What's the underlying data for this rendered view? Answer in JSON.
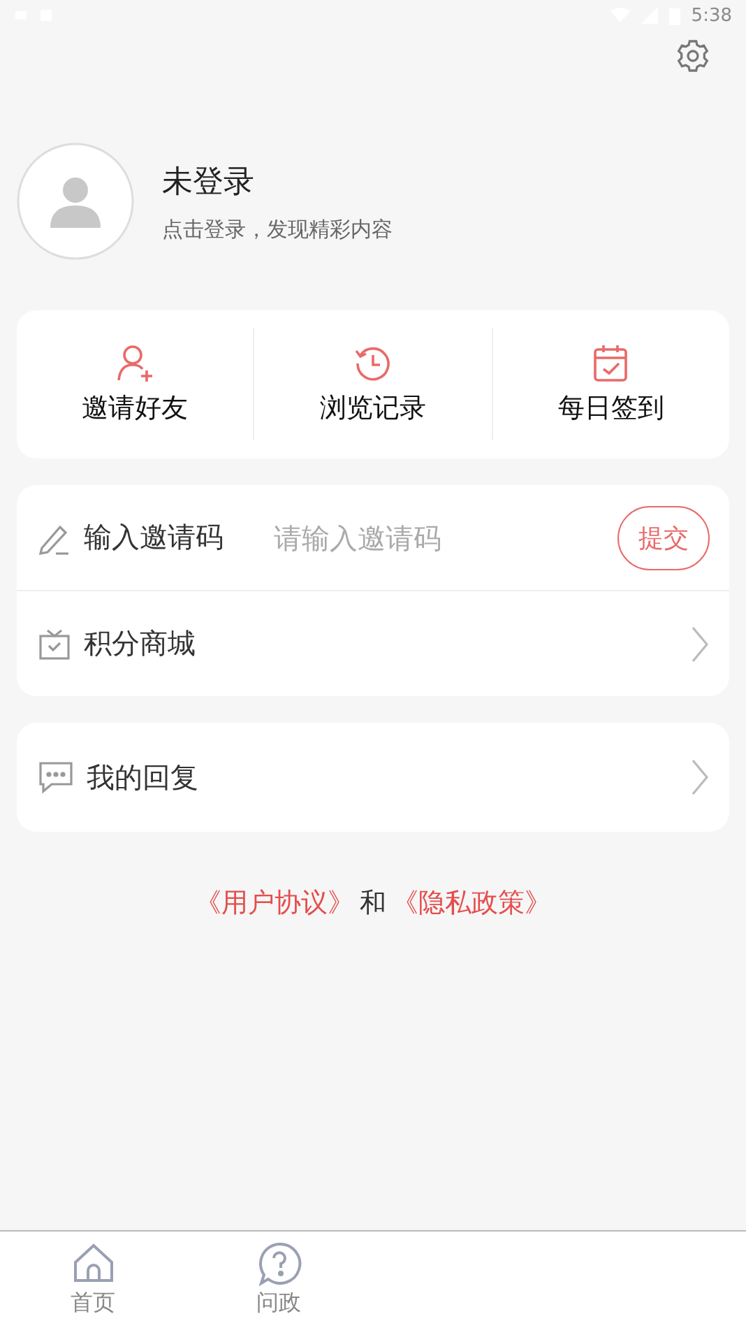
{
  "status_bar": {
    "time": "5:38"
  },
  "profile": {
    "name": "未登录",
    "hint": "点击登录，发现精彩内容"
  },
  "quick_actions": [
    {
      "kind": "invite",
      "label": "邀请好友"
    },
    {
      "kind": "history",
      "label": "浏览记录"
    },
    {
      "kind": "checkin",
      "label": "每日签到"
    }
  ],
  "invite_code": {
    "label": "输入邀请码",
    "placeholder": "请输入邀请码",
    "button": "提交"
  },
  "menu_items": [
    {
      "kind": "mall",
      "label": "积分商城"
    },
    {
      "kind": "reply",
      "label": "我的回复"
    }
  ],
  "agreement": {
    "terms": "《用户协议》",
    "joiner": "和",
    "privacy": "《隐私政策》"
  },
  "tab_bar": [
    {
      "kind": "home",
      "label": "首页"
    },
    {
      "kind": "question",
      "label": "问政"
    }
  ]
}
